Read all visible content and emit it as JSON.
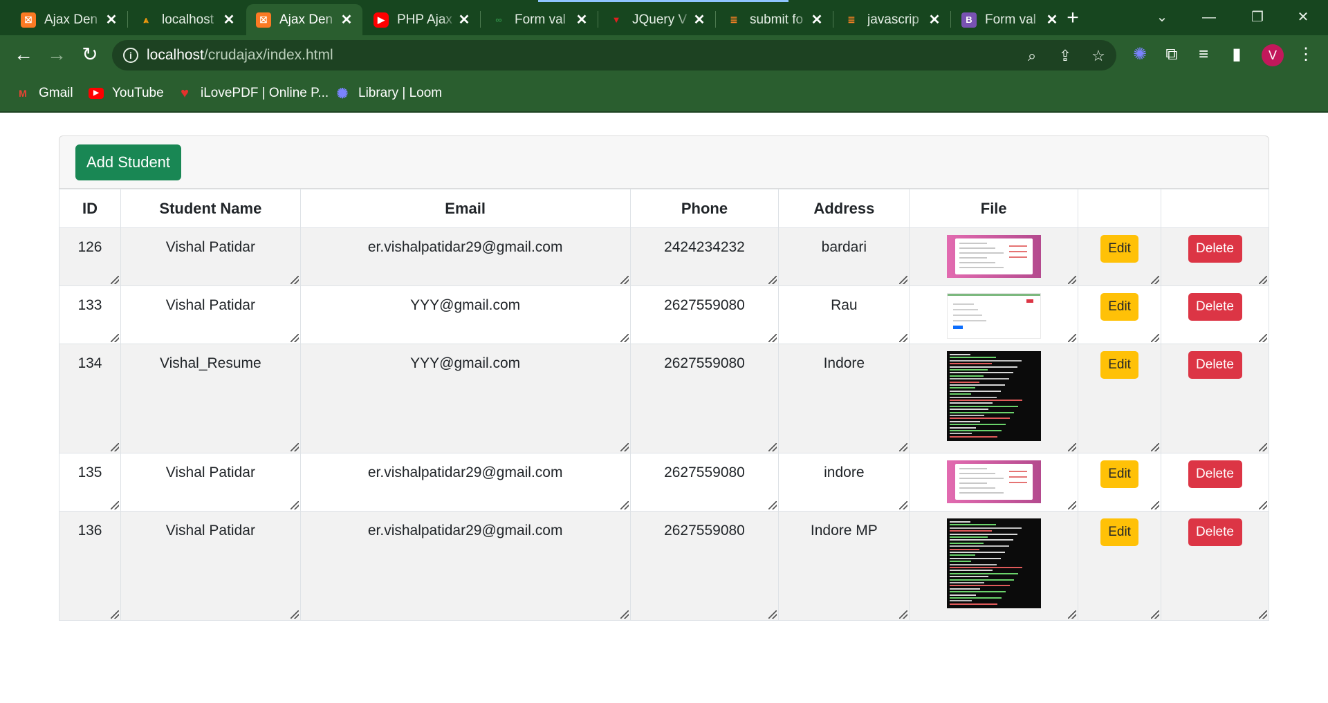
{
  "browser": {
    "tabs": [
      {
        "title": "Ajax Den",
        "icon": "xampp-icon",
        "active": false
      },
      {
        "title": "localhost",
        "icon": "phpmyadmin-icon",
        "active": false
      },
      {
        "title": "Ajax Den",
        "icon": "xampp-icon",
        "active": true
      },
      {
        "title": "PHP Ajax",
        "icon": "youtube-icon",
        "active": false
      },
      {
        "title": "Form val",
        "icon": "geeksforgeeks-icon",
        "active": false
      },
      {
        "title": "JQuery V",
        "icon": "jquery-validation-icon",
        "active": false
      },
      {
        "title": "submit fo",
        "icon": "stackoverflow-icon",
        "active": false
      },
      {
        "title": "javascrip",
        "icon": "stackoverflow-icon",
        "active": false
      },
      {
        "title": "Form val",
        "icon": "bootstrap-icon",
        "active": false
      }
    ],
    "close_glyph": "✕",
    "new_tab_glyph": "+",
    "url_host": "localhost",
    "url_path": "/crudajax/index.html",
    "avatar_letter": "V",
    "bookmarks": [
      {
        "label": "Gmail",
        "icon": "gmail-icon"
      },
      {
        "label": "YouTube",
        "icon": "youtube-icon"
      },
      {
        "label": "iLovePDF | Online P...",
        "icon": "ilovepdf-icon"
      },
      {
        "label": "Library | Loom",
        "icon": "loom-icon"
      }
    ]
  },
  "page": {
    "add_button_label": "Add Student",
    "table": {
      "headers": [
        "ID",
        "Student Name",
        "Email",
        "Phone",
        "Address",
        "File",
        "",
        ""
      ],
      "edit_label": "Edit",
      "delete_label": "Delete",
      "rows": [
        {
          "id": "126",
          "name": "Vishal Patidar",
          "email": "er.vishalpatidar29@gmail.com",
          "phone": "2424234232",
          "address": "bardari",
          "file_thumb": "pink-form-screenshot"
        },
        {
          "id": "133",
          "name": "Vishal Patidar",
          "email": "YYY@gmail.com",
          "phone": "2627559080",
          "address": "Rau",
          "file_thumb": "white-page-screenshot"
        },
        {
          "id": "134",
          "name": "Vishal_Resume",
          "email": "YYY@gmail.com",
          "phone": "2627559080",
          "address": "Indore",
          "file_thumb": "terminal-screenshot"
        },
        {
          "id": "135",
          "name": "Vishal Patidar",
          "email": "er.vishalpatidar29@gmail.com",
          "phone": "2627559080",
          "address": "indore",
          "file_thumb": "pink-form-screenshot"
        },
        {
          "id": "136",
          "name": "Vishal Patidar",
          "email": "er.vishalpatidar29@gmail.com",
          "phone": "2627559080",
          "address": "Indore MP",
          "file_thumb": "terminal-screenshot"
        }
      ]
    }
  },
  "colors": {
    "chrome_dark": "#17461f",
    "chrome": "#2a5e2f",
    "add_button": "#198754",
    "edit_button": "#ffc107",
    "delete_button": "#dc3545"
  }
}
